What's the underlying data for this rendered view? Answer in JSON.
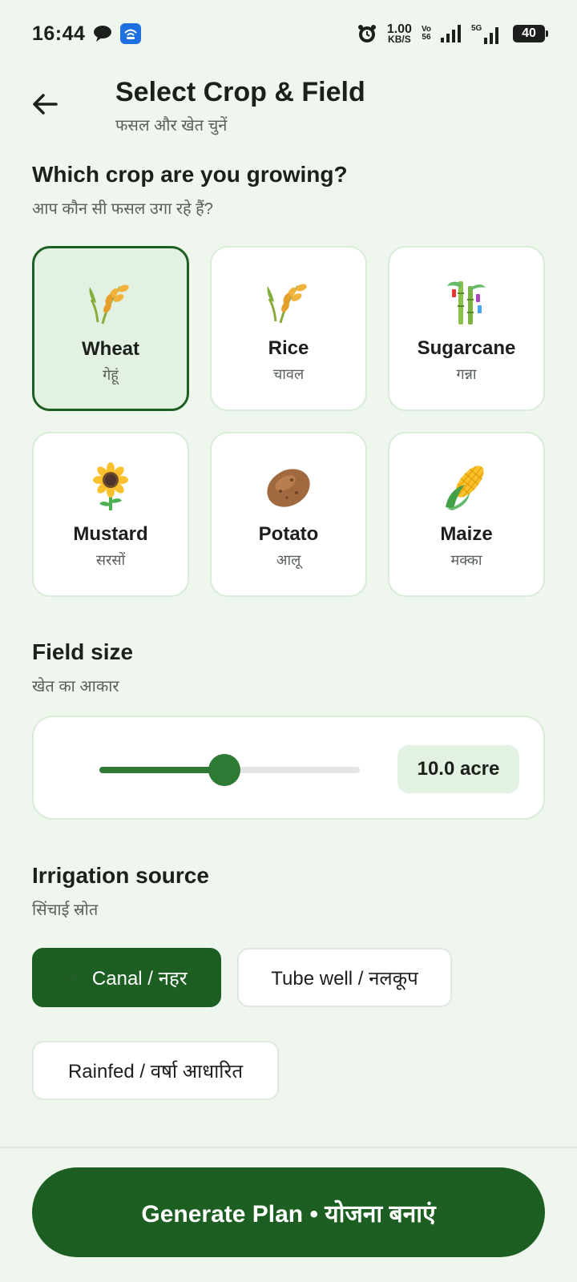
{
  "status_bar": {
    "time": "16:44",
    "speed_value": "1.00",
    "speed_unit": "KB/S",
    "vo_top": "Vo",
    "vo_bottom": "56",
    "network": "5G",
    "battery": "40"
  },
  "header": {
    "title": "Select Crop & Field",
    "subtitle": "फसल और खेत चुनें"
  },
  "crop_section": {
    "title": "Which crop are you growing?",
    "subtitle": "आप कौन सी फसल उगा रहे हैं?",
    "crops": [
      {
        "name": "Wheat",
        "hindi": "गेहूं",
        "icon": "wheat-icon",
        "selected": true
      },
      {
        "name": "Rice",
        "hindi": "चावल",
        "icon": "rice-icon",
        "selected": false
      },
      {
        "name": "Sugarcane",
        "hindi": "गन्ना",
        "icon": "sugarcane-icon",
        "selected": false
      },
      {
        "name": "Mustard",
        "hindi": "सरसों",
        "icon": "sunflower-icon",
        "selected": false
      },
      {
        "name": "Potato",
        "hindi": "आलू",
        "icon": "potato-icon",
        "selected": false
      },
      {
        "name": "Maize",
        "hindi": "मक्का",
        "icon": "corn-icon",
        "selected": false
      }
    ]
  },
  "field_section": {
    "title": "Field size",
    "subtitle": "खेत का आकार",
    "slider_fraction": 0.48,
    "value_label": "10.0 acre"
  },
  "irrigation_section": {
    "title": "Irrigation source",
    "subtitle": "सिंचाई स्रोत",
    "options": [
      {
        "label": "Canal / नहर",
        "selected": true
      },
      {
        "label": "Tube well / नलकूप",
        "selected": false
      },
      {
        "label": "Rainfed / वर्षा आधारित",
        "selected": false
      }
    ]
  },
  "cta": {
    "label": "Generate Plan • योजना बनाएं"
  },
  "colors": {
    "background": "#eef6ed",
    "primary": "#1d5e22",
    "slider": "#2e7a34",
    "selected_card": "#e3f1e2"
  }
}
